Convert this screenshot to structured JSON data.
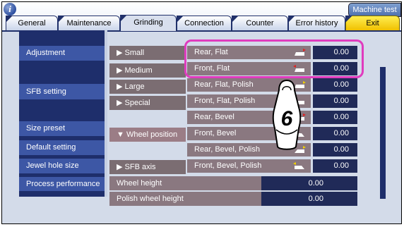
{
  "header": {
    "machine_test": "Machine test"
  },
  "tabs": [
    {
      "label": "General"
    },
    {
      "label": "Maintenance"
    },
    {
      "label": "Grinding"
    },
    {
      "label": "Connection"
    },
    {
      "label": "Counter"
    },
    {
      "label": "Error history"
    },
    {
      "label": "Exit"
    }
  ],
  "left_menu": [
    {
      "label": "Adjustment"
    },
    {
      "label": "SFB setting"
    },
    {
      "label": "Size preset"
    },
    {
      "label": "Default setting"
    },
    {
      "label": "Jewel hole size"
    },
    {
      "label": "Process performance"
    }
  ],
  "mid_menu": [
    {
      "label": "▶ Small"
    },
    {
      "label": "▶ Medium"
    },
    {
      "label": "▶ Large"
    },
    {
      "label": "▶ Special"
    },
    {
      "label": "▼ Wheel position"
    },
    {
      "label": "▶ SFB axis"
    }
  ],
  "rows": [
    {
      "label": "Rear, Flat",
      "value": "0.00"
    },
    {
      "label": "Front, Flat",
      "value": "0.00"
    },
    {
      "label": "Rear, Flat, Polish",
      "value": "0.00"
    },
    {
      "label": "Front, Flat, Polish",
      "value": "0.00"
    },
    {
      "label": "Rear, Bevel",
      "value": "0.00"
    },
    {
      "label": "Front, Bevel",
      "value": "0.00"
    },
    {
      "label": "Rear, Bevel, Polish",
      "value": "0.00"
    },
    {
      "label": "Front, Bevel, Polish",
      "value": "0.00"
    }
  ],
  "bottom_rows": [
    {
      "label": "Wheel height",
      "value": "0.00"
    },
    {
      "label": "Polish wheel height",
      "value": "0.00"
    }
  ],
  "callout": {
    "number": "6"
  },
  "colors": {
    "highlight": "#e03cbe",
    "exit_tab": "#f5d200",
    "value_bg": "#202a58"
  }
}
